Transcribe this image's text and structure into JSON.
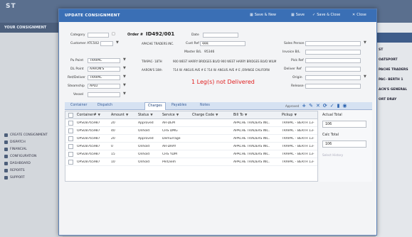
{
  "app": {
    "logo_text": "ST",
    "brand": "YOUR CONSIGNMENT",
    "sidebar_items": [
      "CREATE CONSIGNMENT",
      "DISPATCH",
      "FINANCIAL",
      "CONFIGURATION",
      "DASHBOARD",
      "REPORTS",
      "SUPPORT"
    ],
    "right_items": [
      "ST",
      "OATSPORT",
      "PACHE TRADERS",
      "PAC- BERTH 1",
      "ACN'S GENERAL",
      "ORT DRAY"
    ]
  },
  "dialog": {
    "title": "UPDATE CONSIGNMENT",
    "buttons": {
      "save_new": "Save & New",
      "save": "Save",
      "save_close": "Save & Close",
      "close": "Close"
    }
  },
  "form": {
    "category_label": "Category",
    "category_value": "",
    "order_label": "Order #",
    "order_value": "ID492/001",
    "date_label": "Date",
    "customer_label": "Customer ATC502",
    "customer_value": "APACHE TRADERS INC.",
    "cust_ref_label": "Cust Ref",
    "cust_ref_value": "qqq",
    "master_bl": "Master B/L",
    "master_bl_value": "95346",
    "sales_person_label": "Sales Person",
    "invoice_label": "Invoice B/L",
    "pu_point_label": "Pu Point",
    "pu_point_value": "TRAPAC",
    "pickup_code": "TRAPAC- 18TH",
    "pickup_address": "900 WEST HARRY BRIDGES BLVD 900 WEST HARRY BRIDGES BLVD WILM",
    "pickup_ref_label": "Pick Ref",
    "dl_point_label": "DL Point",
    "dl_point_value": "AARON'S",
    "delivery_code": "AARON'S 18th",
    "delivery_address": "714 W. ANGUS AVE # E 714 W. ANGUS AVE # E ,ORANGE CALIFORN",
    "deliver_ref_label": "Deliver Ref",
    "ret_label": "Ret/Deliver",
    "ret_value": "TRAPAC",
    "origin_label": "Origin",
    "steamship_label": "Steamship",
    "steamship_value": "APLU",
    "vessel_label": "Vessel",
    "release_label": "Release #",
    "alert": "1 Leg(s) not Delivered"
  },
  "tabs": [
    "Container",
    "Dispatch",
    "Charges",
    "Payables",
    "Notes"
  ],
  "tab_active": "Charges",
  "toolbar_label": "Approved",
  "grid": {
    "headers": [
      "Container#",
      "Amount",
      "Status",
      "Service",
      "Charge Code",
      "Bill To",
      "Pickup"
    ],
    "rows": [
      [
        "OPSU8765987",
        "20",
        "Approved",
        "AR-DEM",
        "",
        "APACHE TRADERS INC.",
        "TRAPAC - BERTH 13-"
      ],
      [
        "OPSU8765987",
        "40",
        "Onhold",
        "CHS DMG",
        "",
        "APACHE TRADERS INC.",
        "TRAPAC - BERTH 13-"
      ],
      [
        "OPSU8765987",
        "20",
        "Approved",
        "Demurrage",
        "",
        "APACHE TRADERS INC.",
        "TRAPAC - BERTH 13-"
      ],
      [
        "OPSU8765987",
        "0",
        "Onhold",
        "AR-DRAY",
        "",
        "APACHE TRADERS INC.",
        "TRAPAC - BERTH 13-"
      ],
      [
        "OPSU8765987",
        "15",
        "Onhold",
        "CHS YDM",
        "",
        "APACHE TRADERS INC.",
        "TRAPAC - BERTH 13-"
      ],
      [
        "OPSU8765987",
        "10",
        "Onhold",
        "PerDiem",
        "",
        "APACHE TRADERS INC.",
        "TRAPAC - BERTH 13-"
      ]
    ]
  },
  "totals": {
    "actual_label": "Actual Total",
    "actual_value": "106",
    "calc_label": "Calc Total",
    "calc_value": "106",
    "more": "Select History"
  },
  "colors": {
    "titlebar": "#3a6fb5",
    "alert": "#e02020",
    "tab_bg": "#d6e2f2"
  }
}
